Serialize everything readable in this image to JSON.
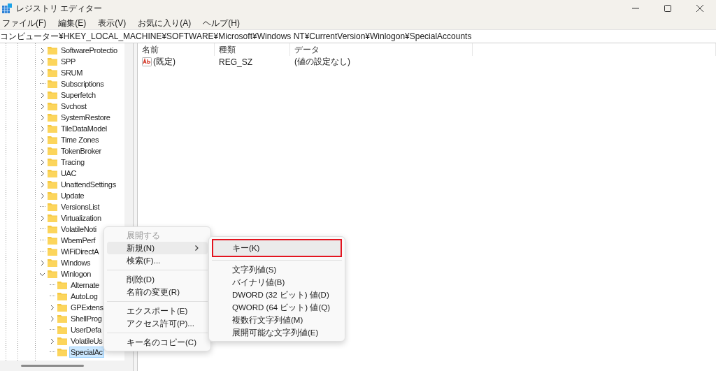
{
  "window": {
    "title": "レジストリ エディター"
  },
  "menu_bar": [
    "ファイル(F)",
    "編集(E)",
    "表示(V)",
    "お気に入り(A)",
    "ヘルプ(H)"
  ],
  "address": "コンピューター¥HKEY_LOCAL_MACHINE¥SOFTWARE¥Microsoft¥Windows NT¥CurrentVersion¥Winlogon¥SpecialAccounts",
  "tree": {
    "items": [
      {
        "label": "SoftwareProtectio",
        "expandable": true,
        "expanded": false,
        "selected": false
      },
      {
        "label": "SPP",
        "expandable": true,
        "expanded": false,
        "selected": false
      },
      {
        "label": "SRUM",
        "expandable": true,
        "expanded": false,
        "selected": false
      },
      {
        "label": "Subscriptions",
        "expandable": false,
        "selected": false
      },
      {
        "label": "Superfetch",
        "expandable": true,
        "expanded": false,
        "selected": false
      },
      {
        "label": "Svchost",
        "expandable": true,
        "expanded": false,
        "selected": false
      },
      {
        "label": "SystemRestore",
        "expandable": true,
        "expanded": false,
        "selected": false
      },
      {
        "label": "TileDataModel",
        "expandable": true,
        "expanded": false,
        "selected": false
      },
      {
        "label": "Time Zones",
        "expandable": true,
        "expanded": false,
        "selected": false
      },
      {
        "label": "TokenBroker",
        "expandable": true,
        "expanded": false,
        "selected": false
      },
      {
        "label": "Tracing",
        "expandable": true,
        "expanded": false,
        "selected": false
      },
      {
        "label": "UAC",
        "expandable": true,
        "expanded": false,
        "selected": false
      },
      {
        "label": "UnattendSettings",
        "expandable": true,
        "expanded": false,
        "selected": false
      },
      {
        "label": "Update",
        "expandable": true,
        "expanded": false,
        "selected": false
      },
      {
        "label": "VersionsList",
        "expandable": false,
        "selected": false
      },
      {
        "label": "Virtualization",
        "expandable": true,
        "expanded": false,
        "selected": false
      },
      {
        "label": "VolatileNoti",
        "expandable": false,
        "selected": false
      },
      {
        "label": "WbemPerf",
        "expandable": false,
        "selected": false
      },
      {
        "label": "WiFiDirectA",
        "expandable": false,
        "selected": false
      },
      {
        "label": "Windows",
        "expandable": true,
        "expanded": false,
        "selected": false
      },
      {
        "label": "Winlogon",
        "expandable": true,
        "expanded": true,
        "selected": false,
        "children": [
          {
            "label": "Alternate",
            "expandable": false,
            "selected": false
          },
          {
            "label": "AutoLog",
            "expandable": false,
            "selected": false
          },
          {
            "label": "GPExtens",
            "expandable": true,
            "expanded": false,
            "selected": false
          },
          {
            "label": "ShellProg",
            "expandable": true,
            "expanded": false,
            "selected": false
          },
          {
            "label": "UserDefa",
            "expandable": false,
            "selected": false
          },
          {
            "label": "VolatileUs",
            "expandable": true,
            "expanded": false,
            "selected": false
          },
          {
            "label": "SpecialAc",
            "expandable": false,
            "selected": true
          }
        ]
      }
    ]
  },
  "values_table": {
    "columns": [
      "名前",
      "種類",
      "データ"
    ],
    "rows": [
      {
        "name": "(既定)",
        "type": "REG_SZ",
        "data": "(値の設定なし)"
      }
    ]
  },
  "context_menu": {
    "items": [
      {
        "kind": "item",
        "label": "展開する",
        "disabled": true,
        "selected": false
      },
      {
        "kind": "submenu",
        "label": "新規(N)",
        "disabled": false,
        "selected": true
      },
      {
        "kind": "item",
        "label": "検索(F)...",
        "disabled": false,
        "selected": false
      },
      {
        "kind": "separator"
      },
      {
        "kind": "item",
        "label": "削除(D)",
        "disabled": false,
        "selected": false
      },
      {
        "kind": "item",
        "label": "名前の変更(R)",
        "disabled": false,
        "selected": false
      },
      {
        "kind": "separator"
      },
      {
        "kind": "item",
        "label": "エクスポート(E)",
        "disabled": false,
        "selected": false
      },
      {
        "kind": "item",
        "label": "アクセス許可(P)...",
        "disabled": false,
        "selected": false
      },
      {
        "kind": "separator"
      },
      {
        "kind": "item",
        "label": "キー名のコピー(C)",
        "disabled": false,
        "selected": false
      }
    ]
  },
  "submenu": {
    "items": [
      {
        "kind": "item",
        "label": "キー(K)",
        "selected": true,
        "annotated": true
      },
      {
        "kind": "separator"
      },
      {
        "kind": "item",
        "label": "文字列値(S)",
        "selected": false,
        "annotated": false
      },
      {
        "kind": "item",
        "label": "バイナリ値(B)",
        "selected": false,
        "annotated": false
      },
      {
        "kind": "item",
        "label": "DWORD (32 ビット) 値(D)",
        "selected": false,
        "annotated": false
      },
      {
        "kind": "item",
        "label": "QWORD (64 ビット) 値(Q)",
        "selected": false,
        "annotated": false
      },
      {
        "kind": "item",
        "label": "複数行文字列値(M)",
        "selected": false,
        "annotated": false
      },
      {
        "kind": "item",
        "label": "展開可能な文字列値(E)",
        "selected": false,
        "annotated": false
      }
    ]
  }
}
